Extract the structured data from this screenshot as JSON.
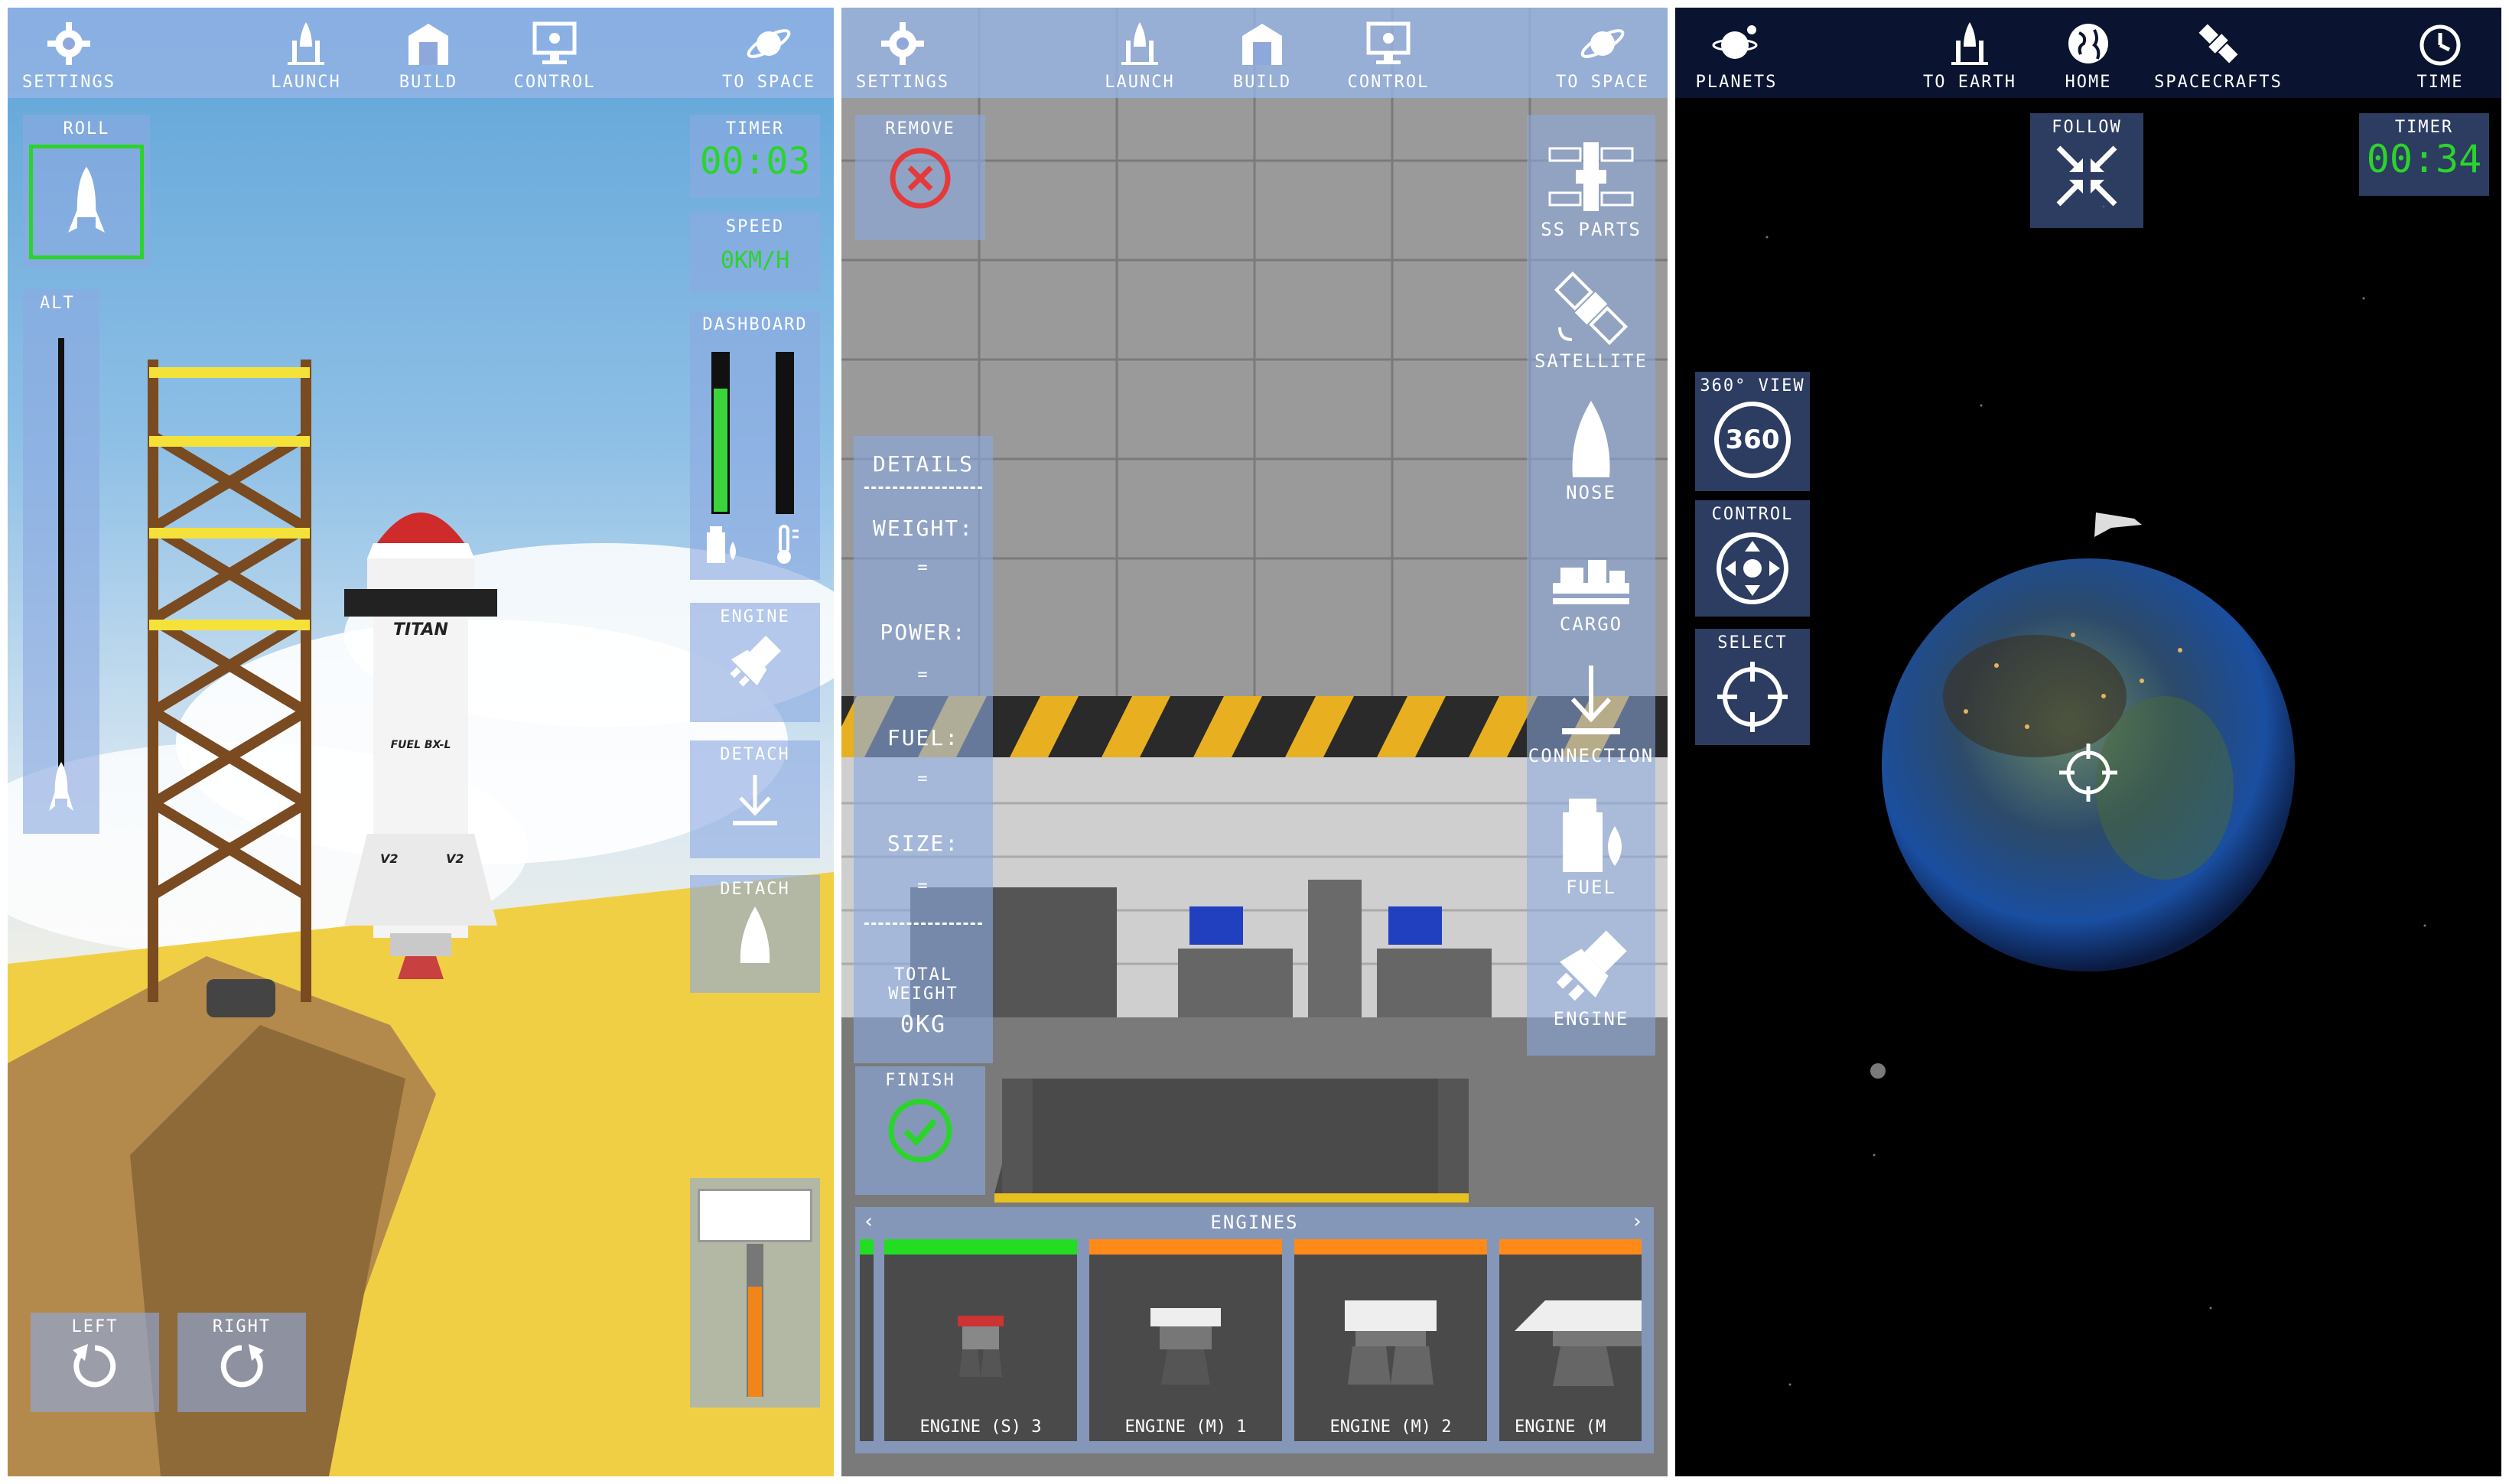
{
  "panel1": {
    "topbar": [
      {
        "label": "SETTINGS",
        "icon": "gear-icon"
      },
      {
        "label": "LAUNCH",
        "icon": "rocket-launch-icon"
      },
      {
        "label": "BUILD",
        "icon": "hangar-icon"
      },
      {
        "label": "CONTROL",
        "icon": "control-monitor-icon"
      },
      {
        "label": "TO SPACE",
        "icon": "planet-icon"
      }
    ],
    "roll_label": "ROLL",
    "alt_label": "ALT",
    "timer_label": "TIMER",
    "timer_value": "00:03",
    "speed_label": "SPEED",
    "speed_value": "0KM/H",
    "dashboard_label": "DASHBOARD",
    "fuel_level": 0.78,
    "temp_level": 0.0,
    "engine_label": "ENGINE",
    "detach1_label": "DETACH",
    "detach2_label": "DETACH",
    "throttle_level": 0.72,
    "left_label": "LEFT",
    "right_label": "RIGHT",
    "rocket_name": "TITAN",
    "rocket_label": "FUEL BX-L",
    "rocket_side_marks": [
      "V2",
      "V2"
    ]
  },
  "panel2": {
    "topbar": [
      {
        "label": "SETTINGS",
        "icon": "gear-icon"
      },
      {
        "label": "LAUNCH",
        "icon": "rocket-launch-icon"
      },
      {
        "label": "BUILD",
        "icon": "hangar-icon"
      },
      {
        "label": "CONTROL",
        "icon": "control-monitor-icon"
      },
      {
        "label": "TO SPACE",
        "icon": "planet-icon"
      }
    ],
    "remove_label": "REMOVE",
    "details": {
      "title": "DETAILS",
      "weight_label": "WEIGHT:",
      "weight_value": "=",
      "power_label": "POWER:",
      "power_value": "=",
      "fuel_label": "FUEL:",
      "fuel_value": "=",
      "size_label": "SIZE:",
      "size_value": "=",
      "total_weight_label": "TOTAL WEIGHT",
      "total_weight_value": "0KG"
    },
    "finish_label": "FINISH",
    "parts": [
      {
        "label": "SS PARTS",
        "icon": "space-station-icon"
      },
      {
        "label": "SATELLITE",
        "icon": "satellite-icon"
      },
      {
        "label": "NOSE",
        "icon": "nose-cone-icon"
      },
      {
        "label": "CARGO",
        "icon": "cargo-icon"
      },
      {
        "label": "CONNECTION",
        "icon": "connection-icon"
      },
      {
        "label": "FUEL",
        "icon": "fuel-icon"
      },
      {
        "label": "ENGINE",
        "icon": "engine-icon"
      }
    ],
    "tray_title": "ENGINES",
    "tray_prev": "‹",
    "tray_next": "›",
    "engines": [
      {
        "label": "ENGINE (S) 3",
        "bar_color": "#22dd22"
      },
      {
        "label": "ENGINE (M) 1",
        "bar_color": "#ff8a1a"
      },
      {
        "label": "ENGINE (M) 2",
        "bar_color": "#ff8a1a"
      },
      {
        "label": "ENGINE (M",
        "bar_color": "#ff8a1a"
      }
    ]
  },
  "panel3": {
    "topbar": [
      {
        "label": "PLANETS",
        "icon": "planets-icon"
      },
      {
        "label": "TO EARTH",
        "icon": "rocket-launch-icon"
      },
      {
        "label": "HOME",
        "icon": "globe-icon"
      },
      {
        "label": "SPACECRAFTS",
        "icon": "satellite-icon"
      },
      {
        "label": "TIME",
        "icon": "clock-icon"
      }
    ],
    "follow_label": "FOLLOW",
    "timer_label": "TIMER",
    "timer_value": "00:34",
    "view360_label": "360° VIEW",
    "view360_badge": "360",
    "control_label": "CONTROL",
    "select_label": "SELECT"
  }
}
